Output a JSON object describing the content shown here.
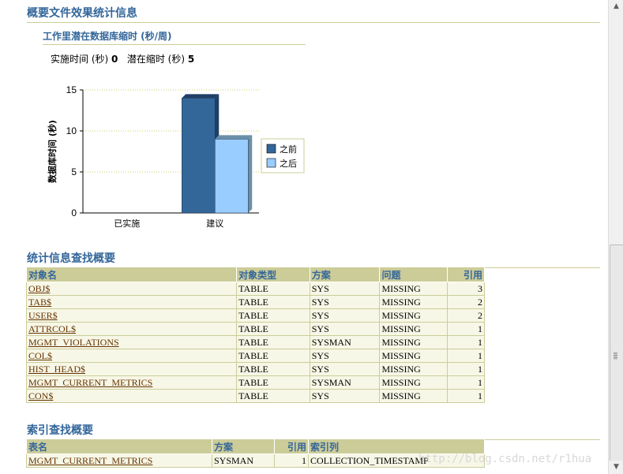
{
  "header": {
    "title": "概要文件效果统计信息"
  },
  "subheader": {
    "title": "工作里潜在数据库缩时 (秒/周)"
  },
  "summary": {
    "impl_label": "实施时间 (秒)",
    "impl_value": "0",
    "potential_label": "潜在缩时 (秒)",
    "potential_value": "5"
  },
  "chart_data": {
    "type": "bar",
    "categories": [
      "已实施",
      "建议"
    ],
    "series": [
      {
        "name": "之前",
        "values": [
          0,
          14
        ],
        "color": "#336699"
      },
      {
        "name": "之后",
        "values": [
          0,
          9
        ],
        "color": "#99ccff"
      }
    ],
    "ylabel": "数据库时间 (秒)",
    "ylim": [
      0,
      15
    ],
    "yticks": [
      0,
      5,
      10,
      15
    ],
    "grid": true,
    "legend_position": "right"
  },
  "stats_section": {
    "title": "统计信息查找概要",
    "columns": [
      "对象名",
      "对象类型",
      "方案",
      "问题",
      "引用"
    ],
    "rows": [
      [
        "OBJ$",
        "TABLE",
        "SYS",
        "MISSING",
        "3"
      ],
      [
        "TAB$",
        "TABLE",
        "SYS",
        "MISSING",
        "2"
      ],
      [
        "USER$",
        "TABLE",
        "SYS",
        "MISSING",
        "2"
      ],
      [
        "ATTRCOL$",
        "TABLE",
        "SYS",
        "MISSING",
        "1"
      ],
      [
        "MGMT_VIOLATIONS",
        "TABLE",
        "SYSMAN",
        "MISSING",
        "1"
      ],
      [
        "COL$",
        "TABLE",
        "SYS",
        "MISSING",
        "1"
      ],
      [
        "HIST_HEAD$",
        "TABLE",
        "SYS",
        "MISSING",
        "1"
      ],
      [
        "MGMT_CURRENT_METRICS",
        "TABLE",
        "SYSMAN",
        "MISSING",
        "1"
      ],
      [
        "CON$",
        "TABLE",
        "SYS",
        "MISSING",
        "1"
      ]
    ]
  },
  "index_section": {
    "title": "索引查找概要",
    "columns": [
      "表名",
      "方案",
      "引用",
      "索引列"
    ],
    "rows": [
      [
        "MGMT_CURRENT_METRICS",
        "SYSMAN",
        "1",
        "COLLECTION_TIMESTAMP"
      ]
    ]
  },
  "watermark": "http://blog.csdn.net/r1hua",
  "scrollbar": {
    "up_icon": "arrow-up-icon",
    "down_icon": "arrow-down-icon"
  }
}
